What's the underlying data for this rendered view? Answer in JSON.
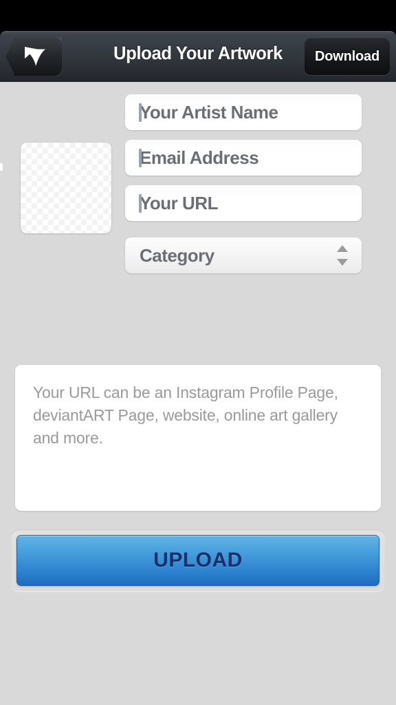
{
  "status_bar": {
    "background": "#000000"
  },
  "navbar": {
    "title": "Upload Your Artwork",
    "back_button": {
      "icon": "back-arrow-icon",
      "label": ""
    },
    "download_button": {
      "label": "Download"
    },
    "background_top": "#4a5058",
    "background_bottom": "#1e2126"
  },
  "content": {
    "background": "#d9d9d9",
    "thumbnail": {
      "name": "artwork-thumbnail",
      "state": "empty",
      "pattern": "transparency-checkerboard"
    },
    "fields": [
      {
        "name": "artist-name",
        "placeholder": "Your Artist Name",
        "value": "",
        "caret": true
      },
      {
        "name": "email",
        "placeholder": "Email Address",
        "value": "",
        "caret": true
      },
      {
        "name": "url",
        "placeholder": "Your URL",
        "value": "",
        "caret": true
      }
    ],
    "category_select": {
      "label": "Category",
      "selected": "Category",
      "stepper_icon": "stepper-up-down-icon"
    },
    "help_textarea": {
      "text": "Your URL can be an Instagram Profile Page, deviantART Page, website, online art gallery and more.",
      "value": ""
    },
    "upload_button": {
      "label": "UPLOAD",
      "color_top": "#63b4e6",
      "color_bottom": "#1f6cc0",
      "text_color": "#19306e"
    }
  }
}
